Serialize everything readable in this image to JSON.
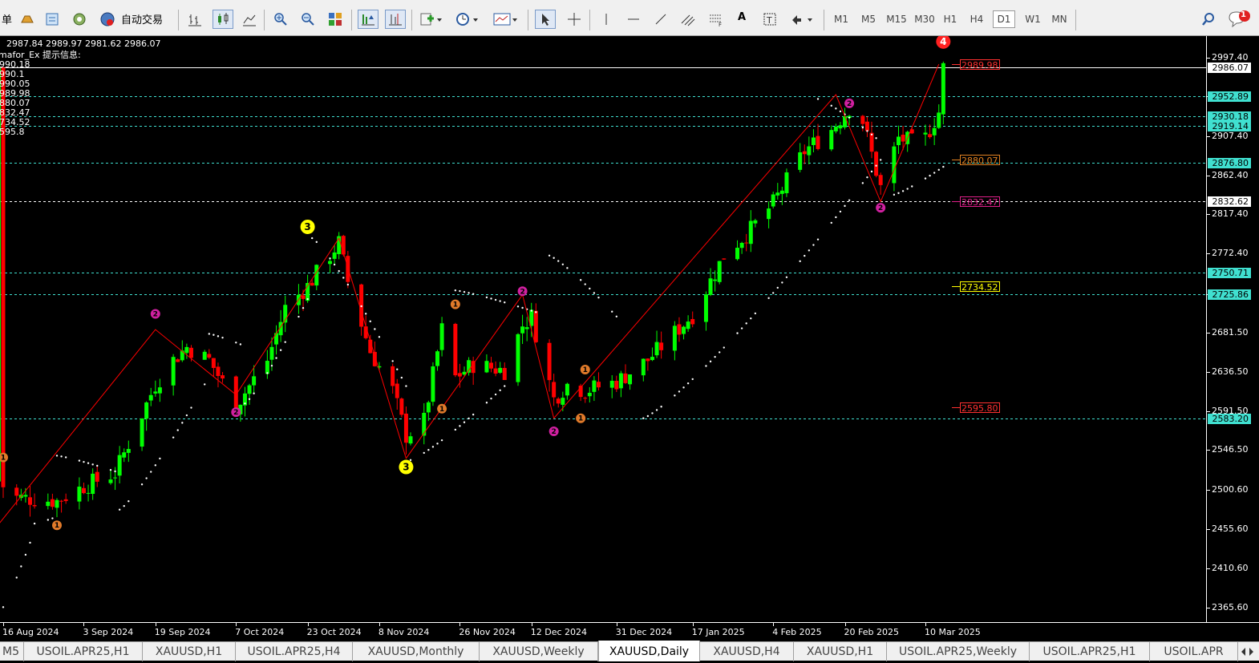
{
  "toolbar": {
    "menu_fragment": "单",
    "autotrade_label": "自动交易",
    "text_tool_label": "A",
    "timeframes": [
      "M1",
      "M5",
      "M15",
      "M30",
      "H1",
      "H4",
      "D1",
      "W1",
      "MN"
    ],
    "active_timeframe": "D1",
    "notification_count": "1"
  },
  "chart": {
    "symbol": "XAUUSD",
    "period": "Daily",
    "ohlc": "2987.84 2989.97 2981.62 2986.07",
    "indicator_info": "mafor_Ex 提示信息:",
    "indicator_levels": [
      "990.18",
      "990.1",
      "990.05",
      "989.98",
      "880.07",
      "832.47",
      "734.52",
      "595.8"
    ],
    "current_price": "2986.07",
    "bull_color": "#00ff00",
    "bear_color": "#ff0000",
    "zigzag_color": "#ff0000",
    "dotted_line_color": "#ffffff",
    "price_scale": [
      "2997.40",
      "2952.89",
      "2907.40",
      "2862.40",
      "2817.40",
      "2772.40",
      "2725.86",
      "2681.50",
      "2636.50",
      "2591.50",
      "2546.50",
      "2500.60",
      "2455.60",
      "2410.60",
      "2365.60"
    ],
    "horizontal_levels": [
      {
        "price": "2986.07",
        "color": "#ffffff",
        "style": "solid"
      },
      {
        "price": "2952.89",
        "color": "#40e0d0",
        "style": "dashed"
      },
      {
        "price": "2930.18",
        "color": "#40e0d0",
        "style": "dashed"
      },
      {
        "price": "2919.14",
        "color": "#40e0d0",
        "style": "dashed"
      },
      {
        "price": "2876.80",
        "color": "#40e0d0",
        "style": "dashed"
      },
      {
        "price": "2832.62",
        "color": "#ffffff",
        "style": "dashed"
      },
      {
        "price": "2750.71",
        "color": "#40e0d0",
        "style": "dashed"
      },
      {
        "price": "2725.86",
        "color": "#40e0d0",
        "style": "dashed"
      },
      {
        "price": "2583.20",
        "color": "#40e0d0",
        "style": "dashed"
      }
    ],
    "level_boxes": [
      {
        "price": "2989.98",
        "color": "#ff3030"
      },
      {
        "price": "2880.07",
        "color": "#e08020"
      },
      {
        "price": "2832.47",
        "color": "#e0208a"
      },
      {
        "price": "2734.52",
        "color": "#ffff00"
      },
      {
        "price": "2595.80",
        "color": "#ff3030"
      }
    ],
    "wave_markers": [
      {
        "label": "1",
        "color": "#e07a2a",
        "date": "16 Aug 2024",
        "price": "2538"
      },
      {
        "label": "1",
        "color": "#e07a2a",
        "date": "28 Aug 2024",
        "price": "2460"
      },
      {
        "label": "2",
        "color": "#d020a0",
        "date": "19 Sep 2024",
        "price": "2703"
      },
      {
        "label": "2",
        "color": "#d020a0",
        "date": "7 Oct 2024",
        "price": "2590"
      },
      {
        "label": "3",
        "color": "#ffff00",
        "date": "23 Oct 2024",
        "price": "2803"
      },
      {
        "label": "3",
        "color": "#ffff00",
        "date": "14 Nov 2024",
        "price": "2527"
      },
      {
        "label": "1",
        "color": "#e07a2a",
        "date": "22 Nov 2024",
        "price": "2594"
      },
      {
        "label": "1",
        "color": "#e07a2a",
        "date": "25 Nov 2024",
        "price": "2714"
      },
      {
        "label": "2",
        "color": "#d020a0",
        "date": "10 Dec 2024",
        "price": "2729"
      },
      {
        "label": "2",
        "color": "#d020a0",
        "date": "17 Dec 2024",
        "price": "2568"
      },
      {
        "label": "1",
        "color": "#e07a2a",
        "date": "24 Dec 2024",
        "price": "2639"
      },
      {
        "label": "1",
        "color": "#e07a2a",
        "date": "23 Dec 2024",
        "price": "2583"
      },
      {
        "label": "2",
        "color": "#d020a0",
        "date": "21 Feb 2025",
        "price": "2945"
      },
      {
        "label": "2",
        "color": "#d020a0",
        "date": "28 Feb 2025",
        "price": "2825"
      },
      {
        "label": "4",
        "color": "#ff2020",
        "date": "14 Mar 2025",
        "price": "3016"
      }
    ]
  },
  "time_axis": [
    "16 Aug 2024",
    "3 Sep 2024",
    "19 Sep 2024",
    "7 Oct 2024",
    "23 Oct 2024",
    "8 Nov 2024",
    "26 Nov 2024",
    "12 Dec 2024",
    "31 Dec 2024",
    "17 Jan 2025",
    "4 Feb 2025",
    "20 Feb 2025",
    "10 Mar 2025"
  ],
  "tabs": [
    "M5",
    "USOIL.APR25,H1",
    "XAUUSD,H1",
    "USOIL.APR25,H4",
    "XAUUSD,Monthly",
    "XAUUSD,Weekly",
    "XAUUSD,Daily",
    "XAUUSD,H4",
    "XAUUSD,H1",
    "USOIL.APR25,Weekly",
    "USOIL.APR25,H1",
    "USOIL.APR"
  ],
  "active_tab": "XAUUSD,Daily"
}
